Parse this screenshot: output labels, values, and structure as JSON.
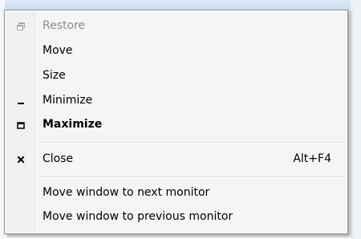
{
  "menu": {
    "items": [
      {
        "label": "Restore",
        "icon": "restore-icon",
        "disabled": true
      },
      {
        "label": "Move",
        "icon": "",
        "disabled": false
      },
      {
        "label": "Size",
        "icon": "",
        "disabled": false
      },
      {
        "label": "Minimize",
        "icon": "minimize-icon",
        "disabled": false
      },
      {
        "label": "Maximize",
        "icon": "maximize-icon",
        "disabled": false,
        "bold": true
      },
      {
        "label": "Close",
        "icon": "close-icon",
        "shortcut": "Alt+F4",
        "disabled": false
      },
      {
        "label": "Move window to next monitor",
        "icon": "",
        "disabled": false
      },
      {
        "label": "Move window to previous monitor",
        "icon": "",
        "disabled": false
      }
    ]
  },
  "colors": {
    "disabled_text": "#8c8c8c",
    "menu_background": "#f5f5f5",
    "menu_border": "#979797"
  }
}
